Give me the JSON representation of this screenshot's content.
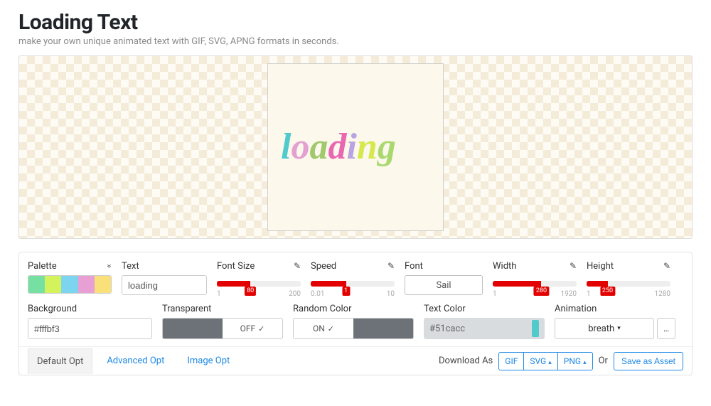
{
  "header": {
    "title": "Loading Text",
    "subtitle": "make your own unique animated text with GIF, SVG, APNG formats in seconds."
  },
  "preview": {
    "text": "loading",
    "letter_colors": [
      "#51cacc",
      "#e4a0d0",
      "#9fc96c",
      "#e967b1",
      "#b9a3e0",
      "#d5e84e",
      "#a9d96e"
    ],
    "canvas_bg": "#fdf8ec"
  },
  "palette": {
    "label": "Palette",
    "colors": [
      "#75e0a2",
      "#d3f25b",
      "#7dd4ef",
      "#e79fd4",
      "#f9e07b"
    ]
  },
  "text_field": {
    "label": "Text",
    "value": "loading"
  },
  "font_size": {
    "label": "Font Size",
    "min": "1",
    "max": "200",
    "value": "80",
    "fill_pct": 40
  },
  "speed": {
    "label": "Speed",
    "min": "0.01",
    "max": "10",
    "value": "1",
    "fill_pct": 42
  },
  "font": {
    "label": "Font",
    "value": "Sail"
  },
  "width": {
    "label": "Width",
    "min": "1",
    "max": "1920",
    "value": "280",
    "fill_pct": 58
  },
  "height": {
    "label": "Height",
    "min": "1",
    "max": "1280",
    "value": "250",
    "fill_pct": 25
  },
  "background": {
    "label": "Background",
    "value": "#fffbf3"
  },
  "transparent": {
    "label": "Transparent",
    "state": "OFF"
  },
  "random_color": {
    "label": "Random Color",
    "state": "ON"
  },
  "text_color": {
    "label": "Text Color",
    "value": "#51cacc",
    "chip": "#51cacc",
    "bg": "#d9dcde"
  },
  "animation": {
    "label": "Animation",
    "value": "breath"
  },
  "tabs": {
    "default": "Default Opt",
    "advanced": "Advanced Opt",
    "image": "Image Opt"
  },
  "download": {
    "label": "Download As",
    "gif": "GIF",
    "svg": "SVG",
    "png": "PNG",
    "or": "Or",
    "save": "Save as Asset"
  }
}
